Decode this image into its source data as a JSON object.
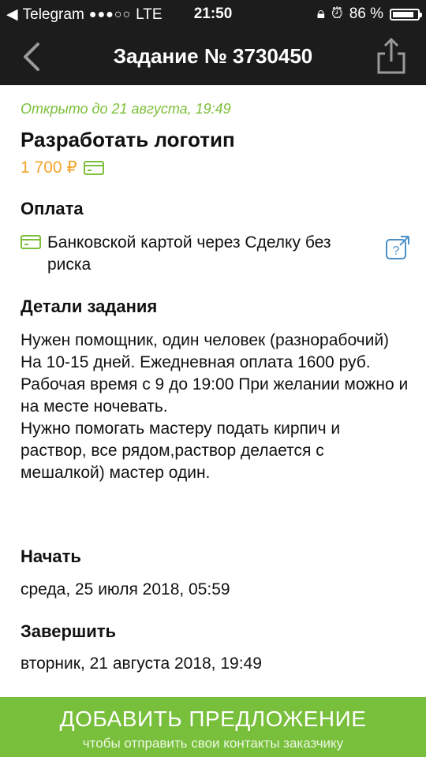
{
  "status_bar": {
    "carrier": "Telegram",
    "signal": "●●●○○",
    "network": "LTE",
    "time": "21:50",
    "battery": "86 %",
    "battery_level": 0.86
  },
  "nav": {
    "title": "Задание № 3730450",
    "back_icon": "chevron-left-icon",
    "share_icon": "share-icon"
  },
  "task": {
    "deadline": "Открыто до 21 августа, 19:49",
    "title": "Разработать логотип",
    "price": "1 700 ₽"
  },
  "payment": {
    "heading": "Оплата",
    "text": "Банковской картой через Сделку без риска"
  },
  "details": {
    "heading": "Детали задания",
    "text": "Нужен помощник, один человек (разнорабочий) На 10-15 дней. Ежедневная оплата 1600 руб.\nРабочая время с 9 до 19:00 При желании можно и на месте ночевать.\nНужно помогать мастеру подать кирпич и раствор, все рядом,раствор делается с мешалкой) мастер один."
  },
  "start": {
    "heading": "Начать",
    "value": "среда, 25 июля 2018, 05:59"
  },
  "finish": {
    "heading": "Завершить",
    "value": "вторник, 21 августа 2018, 19:49"
  },
  "cta": {
    "title": "ДОБАВИТЬ ПРЕДЛОЖЕНИЕ",
    "subtitle": "чтобы отправить свои контакты заказчику"
  },
  "colors": {
    "accent_green": "#78bf3b",
    "price_orange": "#f3a52d",
    "bar_dark": "#1c1c1c"
  }
}
